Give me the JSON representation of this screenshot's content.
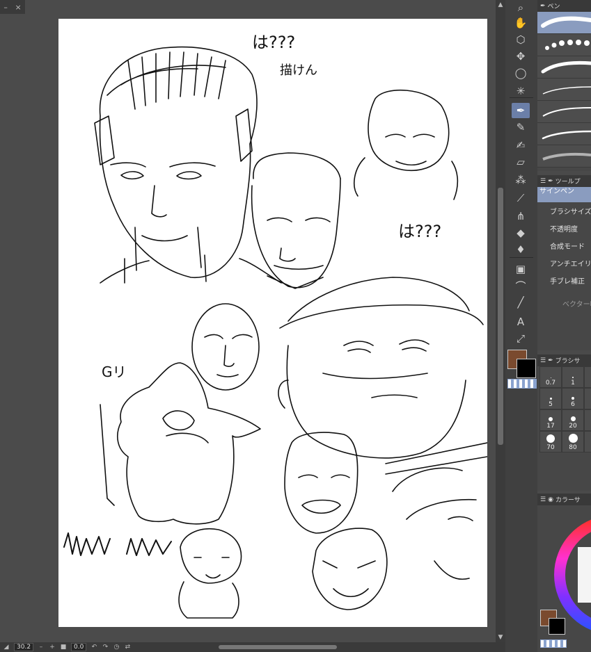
{
  "tab": {
    "minimize": "–",
    "close": "×"
  },
  "sketch_text": {
    "top_note_1": "は???",
    "top_note_2": "描けん",
    "right_note": "は???",
    "left_note": "Gリ"
  },
  "status": {
    "zoom": "30.2",
    "minus": "–",
    "plus": "+",
    "angle": "0.0"
  },
  "tools": [
    {
      "icon": "zoom-icon",
      "glyph": "⌕"
    },
    {
      "icon": "hand-icon",
      "glyph": "✋"
    },
    {
      "icon": "rotate-object-icon",
      "glyph": "⬡"
    },
    {
      "icon": "move-icon",
      "glyph": "✥"
    },
    {
      "icon": "lasso-icon",
      "glyph": "◯"
    },
    {
      "icon": "magic-wand-icon",
      "glyph": "✳"
    },
    {
      "icon": "pen-icon",
      "glyph": "✒",
      "active": true
    },
    {
      "icon": "pencil-icon",
      "glyph": "✎"
    },
    {
      "icon": "brush-icon",
      "glyph": "✍"
    },
    {
      "icon": "eraser-icon",
      "glyph": "▱"
    },
    {
      "icon": "decoration-icon",
      "glyph": "⁂"
    },
    {
      "icon": "eyedropper-icon",
      "glyph": "⟋"
    },
    {
      "icon": "grass-brush-icon",
      "glyph": "⋔"
    },
    {
      "icon": "fill-icon",
      "glyph": "◆"
    },
    {
      "icon": "blend-icon",
      "glyph": "♦"
    },
    {
      "icon": "gradient-icon",
      "glyph": "▣"
    },
    {
      "icon": "curve-icon",
      "glyph": "⌒"
    },
    {
      "icon": "line-icon",
      "glyph": "╱"
    },
    {
      "icon": "text-icon",
      "glyph": "A"
    },
    {
      "icon": "correct-line-icon",
      "glyph": "⤢"
    }
  ],
  "brush_panel": {
    "title": "ペン"
  },
  "tool_property": {
    "title": "ツールプ",
    "brush_name": "サインペン",
    "rows": [
      "ブラシサイズ",
      "不透明度",
      "合成モード",
      "アンチエイリア",
      "手ブレ補正"
    ],
    "vector_label": "ベクター吸"
  },
  "brush_size": {
    "title": "ブラシサ",
    "sizes": [
      "0.7",
      "1",
      "5",
      "6",
      "17",
      "20",
      "70",
      "80"
    ]
  },
  "color_panel": {
    "title": "カラーサ"
  },
  "colors": {
    "main": "#7a4a2e",
    "sub": "#000000",
    "accent": "#6b7fa8"
  }
}
